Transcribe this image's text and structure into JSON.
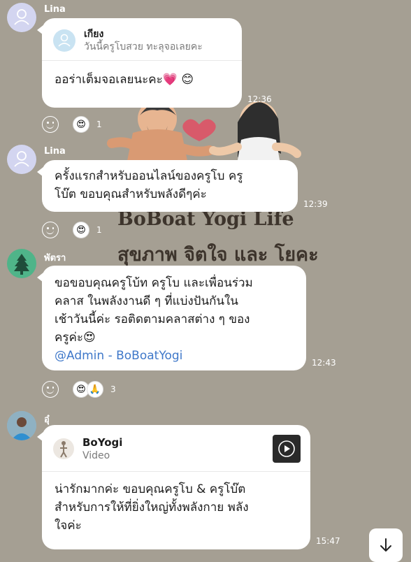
{
  "background": {
    "title": "BoBoat Yogi Life",
    "subtitle": "สุขภาพ จิตใจ และ โยคะ"
  },
  "messages": [
    {
      "sender": "Lina",
      "reply": {
        "name": "เกียง",
        "text": "วันนี้ครูโบสวย ทะลุจอเลยคะ"
      },
      "text": "ออร่าเต็มจอเลยนะคะ💗 😊",
      "time": "12:36",
      "reactions": {
        "emoji": "😍",
        "count": "1"
      }
    },
    {
      "sender": "Lina",
      "lines": [
        "ครั้งแรกสำหรับออนไลน์ของครูโบ ครู",
        "โบ๊ต ขอบคุณสำหรับพลังดีๆค่ะ"
      ],
      "time": "12:39",
      "reactions": {
        "emoji": "😍",
        "count": "1"
      }
    },
    {
      "sender": "พัตรา",
      "lines": [
        "ขอขอบคุณครูโบ้ท ครูโบ และเพื่อนร่วม",
        "คลาส ในพลังงานดี ๆ ที่แบ่งปันกันใน",
        "เช้าวันนี้ค่ะ รอติดตามคลาสต่าง ๆ ของ",
        "ครูค่ะ😍"
      ],
      "mention": "@Admin - BoBoatYogi",
      "time": "12:43",
      "reactions": {
        "emoji": "😍",
        "emoji2": "🙏",
        "count": "3"
      }
    },
    {
      "sender": "อุ๋",
      "video": {
        "title": "BoYogi",
        "subtitle": "Video"
      },
      "lines": [
        "น่ารักมากค่ะ ขอบคุณครูโบ & ครูโบ๊ต",
        "สำหรับการให้ที่ยิ่งใหญ่ทั้งพลังกาย พลัง",
        "ใจค่ะ"
      ],
      "time": "15:47"
    }
  ],
  "icons": {
    "avatar_default": "person-icon",
    "avatar_tree": "tree-icon",
    "reaction_button": "smiley-icon",
    "scroll_down": "arrow-down-icon",
    "play": "play-icon"
  },
  "colors": {
    "background": "#a59f93",
    "bubble": "#ffffff",
    "mention": "#3f78c9",
    "tree_avatar": "#4fb489"
  }
}
